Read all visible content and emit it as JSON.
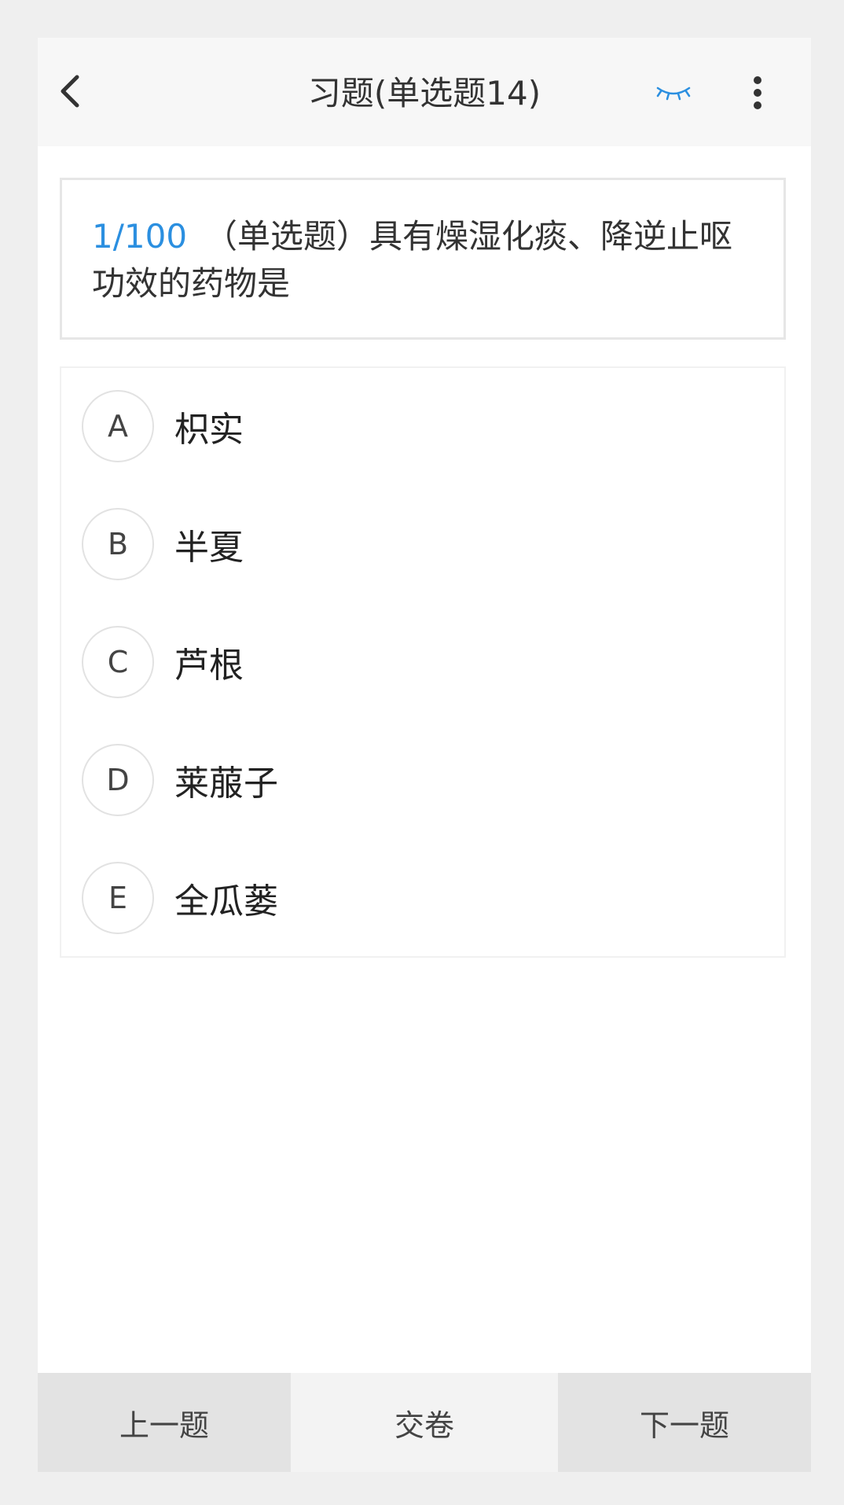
{
  "header": {
    "title": "习题(单选题14)",
    "back_icon": "chevron-left-icon",
    "eye_icon": "eye-closed-icon",
    "more_icon": "more-vertical-icon",
    "accent_color": "#2b8fe0"
  },
  "question": {
    "progress": "1/100",
    "text": "（单选题）具有燥湿化痰、降逆止呕功效的药物是"
  },
  "options": [
    {
      "letter": "A",
      "text": "枳实"
    },
    {
      "letter": "B",
      "text": "半夏"
    },
    {
      "letter": "C",
      "text": "芦根"
    },
    {
      "letter": "D",
      "text": "莱菔子"
    },
    {
      "letter": "E",
      "text": "全瓜蒌"
    }
  ],
  "footer": {
    "prev_label": "上一题",
    "submit_label": "交卷",
    "next_label": "下一题"
  }
}
